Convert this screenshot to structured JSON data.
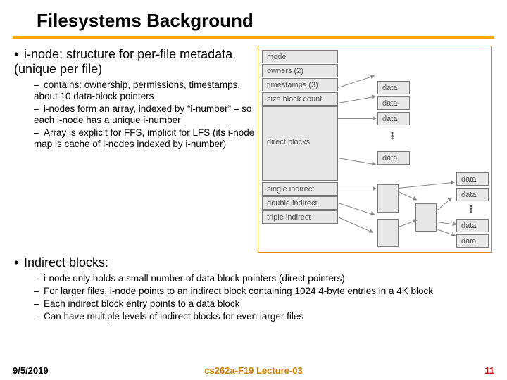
{
  "title": "Filesystems Background",
  "bullets_top": {
    "b1": "i-node: structure for per-file metadata (unique per file)",
    "b1_subs": [
      "contains: ownership, permissions, timestamps, about 10 data-block pointers",
      "i-nodes form an array, indexed by “i-number” – so each i-node has a unique i-number",
      "Array is explicit for FFS, implicit for LFS (its i-node map is cache of i-nodes indexed by i-number)"
    ]
  },
  "bullets_bottom": {
    "b2": "Indirect blocks:",
    "b2_subs": [
      "i-node only holds a small number of data block pointers (direct pointers)",
      "For larger files, i-node points to an indirect block containing 1024 4-byte entries in a 4K block",
      "Each indirect block entry points to a data block",
      "Can have multiple levels of indirect blocks for even larger files"
    ]
  },
  "diagram": {
    "mode": "mode",
    "owners": "owners (2)",
    "timestamps": "timestamps (3)",
    "size": "size block count",
    "direct": "direct blocks",
    "single": "single indirect",
    "double": "double indirect",
    "triple": "triple indirect",
    "data": "data"
  },
  "footer": {
    "date": "9/5/2019",
    "center": "cs262a-F19 Lecture-03",
    "page": "11"
  }
}
